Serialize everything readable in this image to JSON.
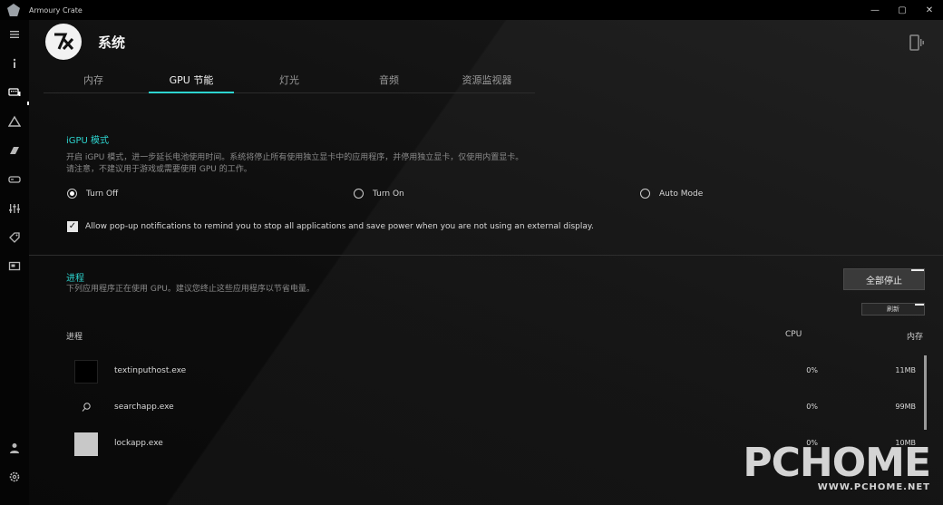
{
  "window": {
    "title": "Armoury Crate",
    "min_label": "—",
    "max_label": "▢",
    "close_label": "✕"
  },
  "header": {
    "title": "系统"
  },
  "tabs": [
    {
      "label": "内存"
    },
    {
      "label": "GPU 节能"
    },
    {
      "label": "灯光"
    },
    {
      "label": "音频"
    },
    {
      "label": "资源监视器"
    }
  ],
  "igpu": {
    "title": "iGPU 模式",
    "desc_line1": "开启 iGPU 模式，进一步延长电池使用时间。系统将停止所有使用独立显卡中的应用程序，并停用独立显卡，仅使用内置显卡。",
    "desc_line2": "请注意，不建议用于游戏或需要使用 GPU 的工作。",
    "options": [
      "Turn Off",
      "Turn On",
      "Auto Mode"
    ],
    "selected": "Turn Off",
    "popup_label": "Allow pop-up notifications to remind you to stop all applications and save power when you are not using an external display.",
    "popup_checked": true
  },
  "process": {
    "title": "进程",
    "desc": "下列应用程序正在使用 GPU。建议您终止这些应用程序以节省电量。",
    "stop_all_label": "全部停止",
    "refresh_label": "刷新",
    "columns": {
      "name": "进程",
      "cpu": "CPU",
      "mem": "内存"
    },
    "rows": [
      {
        "name": "textinputhost.exe",
        "cpu": "0%",
        "mem": "11MB",
        "icon": "black-square-icon"
      },
      {
        "name": "searchapp.exe",
        "cpu": "0%",
        "mem": "99MB",
        "icon": "search-icon"
      },
      {
        "name": "lockapp.exe",
        "cpu": "0%",
        "mem": "10MB",
        "icon": "gray-square-icon"
      }
    ]
  },
  "watermark": {
    "main": "PCHOME",
    "sub": "WWW.PCHOME.NET"
  },
  "colors": {
    "accent": "#2dd4cf",
    "background": "#0c0c0c"
  }
}
